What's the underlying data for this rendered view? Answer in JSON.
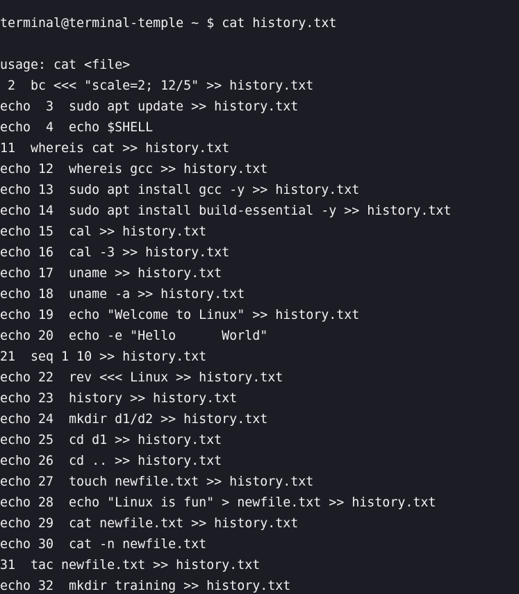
{
  "prompt": {
    "user_host": "terminal@terminal-temple",
    "cwd": "~",
    "symbol": "$",
    "command": "cat history.txt"
  },
  "output": [
    "usage: cat <file>",
    " 2  bc <<< \"scale=2; 12/5\" >> history.txt",
    "echo  3  sudo apt update >> history.txt",
    "echo  4  echo $SHELL",
    "11  whereis cat >> history.txt",
    "echo 12  whereis gcc >> history.txt",
    "echo 13  sudo apt install gcc -y >> history.txt",
    "echo 14  sudo apt install build-essential -y >> history.txt",
    "echo 15  cal >> history.txt",
    "echo 16  cal -3 >> history.txt",
    "echo 17  uname >> history.txt",
    "echo 18  uname -a >> history.txt",
    "echo 19  echo \"Welcome to Linux\" >> history.txt",
    "echo 20  echo -e \"Hello      World\"",
    "21  seq 1 10 >> history.txt",
    "echo 22  rev <<< Linux >> history.txt",
    "echo 23  history >> history.txt",
    "echo 24  mkdir d1/d2 >> history.txt",
    "echo 25  cd d1 >> history.txt",
    "echo 26  cd .. >> history.txt",
    "echo 27  touch newfile.txt >> history.txt",
    "echo 28  echo \"Linux is fun\" > newfile.txt >> history.txt",
    "echo 29  cat newfile.txt >> history.txt",
    "echo 30  cat -n newfile.txt",
    "31  tac newfile.txt >> history.txt",
    "echo 32  mkdir training >> history.txt"
  ],
  "colors": {
    "background": "#1c1c25",
    "text": "#f2f2f2"
  }
}
